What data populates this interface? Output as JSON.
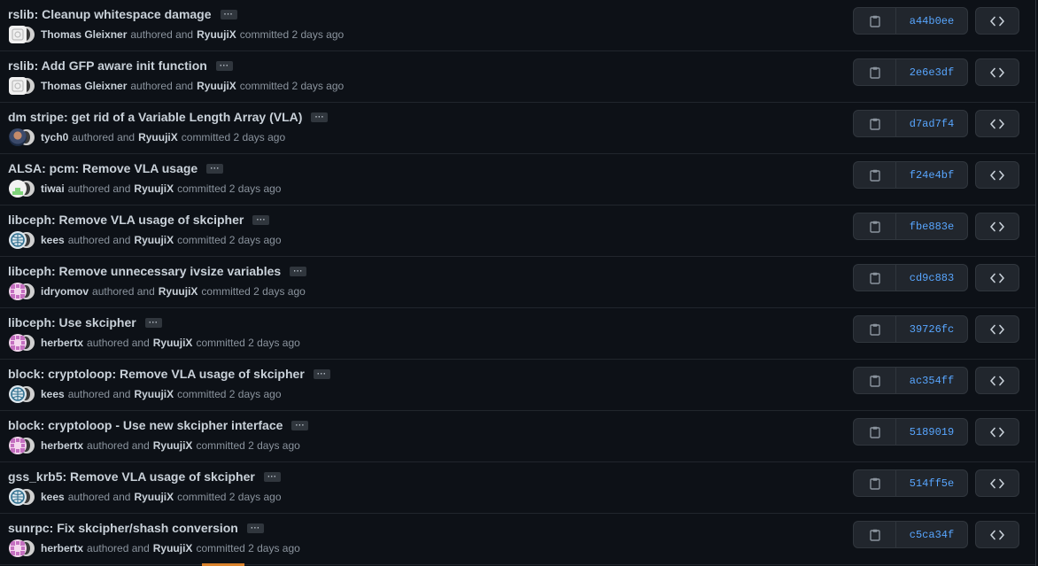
{
  "commits": [
    {
      "title": "rslib: Cleanup whitespace damage",
      "author": "Thomas Gleixner",
      "authored_text": "authored and",
      "committer": "RyuujiX",
      "committed_text": "committed 2 days ago",
      "sha": "a44b0ee",
      "avatar": "blank"
    },
    {
      "title": "rslib: Add GFP aware init function",
      "author": "Thomas Gleixner",
      "authored_text": "authored and",
      "committer": "RyuujiX",
      "committed_text": "committed 2 days ago",
      "sha": "2e6e3df",
      "avatar": "blank"
    },
    {
      "title": "dm stripe: get rid of a Variable Length Array (VLA)",
      "author": "tych0",
      "authored_text": "authored and",
      "committer": "RyuujiX",
      "committed_text": "committed 2 days ago",
      "sha": "d7ad7f4",
      "avatar": "photo"
    },
    {
      "title": "ALSA: pcm: Remove VLA usage",
      "author": "tiwai",
      "authored_text": "authored and",
      "committer": "RyuujiX",
      "committed_text": "committed 2 days ago",
      "sha": "f24e4bf",
      "avatar": "green"
    },
    {
      "title": "libceph: Remove VLA usage of skcipher",
      "author": "kees",
      "authored_text": "authored and",
      "committer": "RyuujiX",
      "committed_text": "committed 2 days ago",
      "sha": "fbe883e",
      "avatar": "globe"
    },
    {
      "title": "libceph: Remove unnecessary ivsize variables",
      "author": "idryomov",
      "authored_text": "authored and",
      "committer": "RyuujiX",
      "committed_text": "committed 2 days ago",
      "sha": "cd9c883",
      "avatar": "pink"
    },
    {
      "title": "libceph: Use skcipher",
      "author": "herbertx",
      "authored_text": "authored and",
      "committer": "RyuujiX",
      "committed_text": "committed 2 days ago",
      "sha": "39726fc",
      "avatar": "pink"
    },
    {
      "title": "block: cryptoloop: Remove VLA usage of skcipher",
      "author": "kees",
      "authored_text": "authored and",
      "committer": "RyuujiX",
      "committed_text": "committed 2 days ago",
      "sha": "ac354ff",
      "avatar": "globe"
    },
    {
      "title": "block: cryptoloop - Use new skcipher interface",
      "author": "herbertx",
      "authored_text": "authored and",
      "committer": "RyuujiX",
      "committed_text": "committed 2 days ago",
      "sha": "5189019",
      "avatar": "pink"
    },
    {
      "title": "gss_krb5: Remove VLA usage of skcipher",
      "author": "kees",
      "authored_text": "authored and",
      "committer": "RyuujiX",
      "committed_text": "committed 2 days ago",
      "sha": "514ff5e",
      "avatar": "globe"
    },
    {
      "title": "sunrpc: Fix skcipher/shash conversion",
      "author": "herbertx",
      "authored_text": "authored and",
      "committer": "RyuujiX",
      "committed_text": "committed 2 days ago",
      "sha": "c5ca34f",
      "avatar": "pink"
    }
  ],
  "icons": {
    "ellipsis": "ellipsis-icon",
    "copy": "clipboard-copy-icon",
    "browse": "code-brackets-icon"
  },
  "colors": {
    "background": "#0d1117",
    "link": "#58a6ff",
    "muted": "#8b949e",
    "text": "#c9d1d9",
    "button_bg": "#21262d",
    "border": "#30363d"
  }
}
